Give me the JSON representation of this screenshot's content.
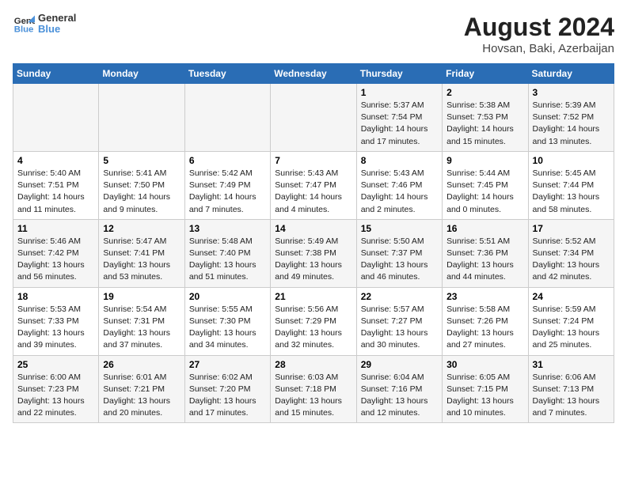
{
  "logo": {
    "line1": "General",
    "line2": "Blue"
  },
  "title": "August 2024",
  "location": "Hovsan, Baki, Azerbaijan",
  "weekdays": [
    "Sunday",
    "Monday",
    "Tuesday",
    "Wednesday",
    "Thursday",
    "Friday",
    "Saturday"
  ],
  "weeks": [
    [
      {
        "day": "",
        "data": ""
      },
      {
        "day": "",
        "data": ""
      },
      {
        "day": "",
        "data": ""
      },
      {
        "day": "",
        "data": ""
      },
      {
        "day": "1",
        "data": "Sunrise: 5:37 AM\nSunset: 7:54 PM\nDaylight: 14 hours\nand 17 minutes."
      },
      {
        "day": "2",
        "data": "Sunrise: 5:38 AM\nSunset: 7:53 PM\nDaylight: 14 hours\nand 15 minutes."
      },
      {
        "day": "3",
        "data": "Sunrise: 5:39 AM\nSunset: 7:52 PM\nDaylight: 14 hours\nand 13 minutes."
      }
    ],
    [
      {
        "day": "4",
        "data": "Sunrise: 5:40 AM\nSunset: 7:51 PM\nDaylight: 14 hours\nand 11 minutes."
      },
      {
        "day": "5",
        "data": "Sunrise: 5:41 AM\nSunset: 7:50 PM\nDaylight: 14 hours\nand 9 minutes."
      },
      {
        "day": "6",
        "data": "Sunrise: 5:42 AM\nSunset: 7:49 PM\nDaylight: 14 hours\nand 7 minutes."
      },
      {
        "day": "7",
        "data": "Sunrise: 5:43 AM\nSunset: 7:47 PM\nDaylight: 14 hours\nand 4 minutes."
      },
      {
        "day": "8",
        "data": "Sunrise: 5:43 AM\nSunset: 7:46 PM\nDaylight: 14 hours\nand 2 minutes."
      },
      {
        "day": "9",
        "data": "Sunrise: 5:44 AM\nSunset: 7:45 PM\nDaylight: 14 hours\nand 0 minutes."
      },
      {
        "day": "10",
        "data": "Sunrise: 5:45 AM\nSunset: 7:44 PM\nDaylight: 13 hours\nand 58 minutes."
      }
    ],
    [
      {
        "day": "11",
        "data": "Sunrise: 5:46 AM\nSunset: 7:42 PM\nDaylight: 13 hours\nand 56 minutes."
      },
      {
        "day": "12",
        "data": "Sunrise: 5:47 AM\nSunset: 7:41 PM\nDaylight: 13 hours\nand 53 minutes."
      },
      {
        "day": "13",
        "data": "Sunrise: 5:48 AM\nSunset: 7:40 PM\nDaylight: 13 hours\nand 51 minutes."
      },
      {
        "day": "14",
        "data": "Sunrise: 5:49 AM\nSunset: 7:38 PM\nDaylight: 13 hours\nand 49 minutes."
      },
      {
        "day": "15",
        "data": "Sunrise: 5:50 AM\nSunset: 7:37 PM\nDaylight: 13 hours\nand 46 minutes."
      },
      {
        "day": "16",
        "data": "Sunrise: 5:51 AM\nSunset: 7:36 PM\nDaylight: 13 hours\nand 44 minutes."
      },
      {
        "day": "17",
        "data": "Sunrise: 5:52 AM\nSunset: 7:34 PM\nDaylight: 13 hours\nand 42 minutes."
      }
    ],
    [
      {
        "day": "18",
        "data": "Sunrise: 5:53 AM\nSunset: 7:33 PM\nDaylight: 13 hours\nand 39 minutes."
      },
      {
        "day": "19",
        "data": "Sunrise: 5:54 AM\nSunset: 7:31 PM\nDaylight: 13 hours\nand 37 minutes."
      },
      {
        "day": "20",
        "data": "Sunrise: 5:55 AM\nSunset: 7:30 PM\nDaylight: 13 hours\nand 34 minutes."
      },
      {
        "day": "21",
        "data": "Sunrise: 5:56 AM\nSunset: 7:29 PM\nDaylight: 13 hours\nand 32 minutes."
      },
      {
        "day": "22",
        "data": "Sunrise: 5:57 AM\nSunset: 7:27 PM\nDaylight: 13 hours\nand 30 minutes."
      },
      {
        "day": "23",
        "data": "Sunrise: 5:58 AM\nSunset: 7:26 PM\nDaylight: 13 hours\nand 27 minutes."
      },
      {
        "day": "24",
        "data": "Sunrise: 5:59 AM\nSunset: 7:24 PM\nDaylight: 13 hours\nand 25 minutes."
      }
    ],
    [
      {
        "day": "25",
        "data": "Sunrise: 6:00 AM\nSunset: 7:23 PM\nDaylight: 13 hours\nand 22 minutes."
      },
      {
        "day": "26",
        "data": "Sunrise: 6:01 AM\nSunset: 7:21 PM\nDaylight: 13 hours\nand 20 minutes."
      },
      {
        "day": "27",
        "data": "Sunrise: 6:02 AM\nSunset: 7:20 PM\nDaylight: 13 hours\nand 17 minutes."
      },
      {
        "day": "28",
        "data": "Sunrise: 6:03 AM\nSunset: 7:18 PM\nDaylight: 13 hours\nand 15 minutes."
      },
      {
        "day": "29",
        "data": "Sunrise: 6:04 AM\nSunset: 7:16 PM\nDaylight: 13 hours\nand 12 minutes."
      },
      {
        "day": "30",
        "data": "Sunrise: 6:05 AM\nSunset: 7:15 PM\nDaylight: 13 hours\nand 10 minutes."
      },
      {
        "day": "31",
        "data": "Sunrise: 6:06 AM\nSunset: 7:13 PM\nDaylight: 13 hours\nand 7 minutes."
      }
    ]
  ]
}
